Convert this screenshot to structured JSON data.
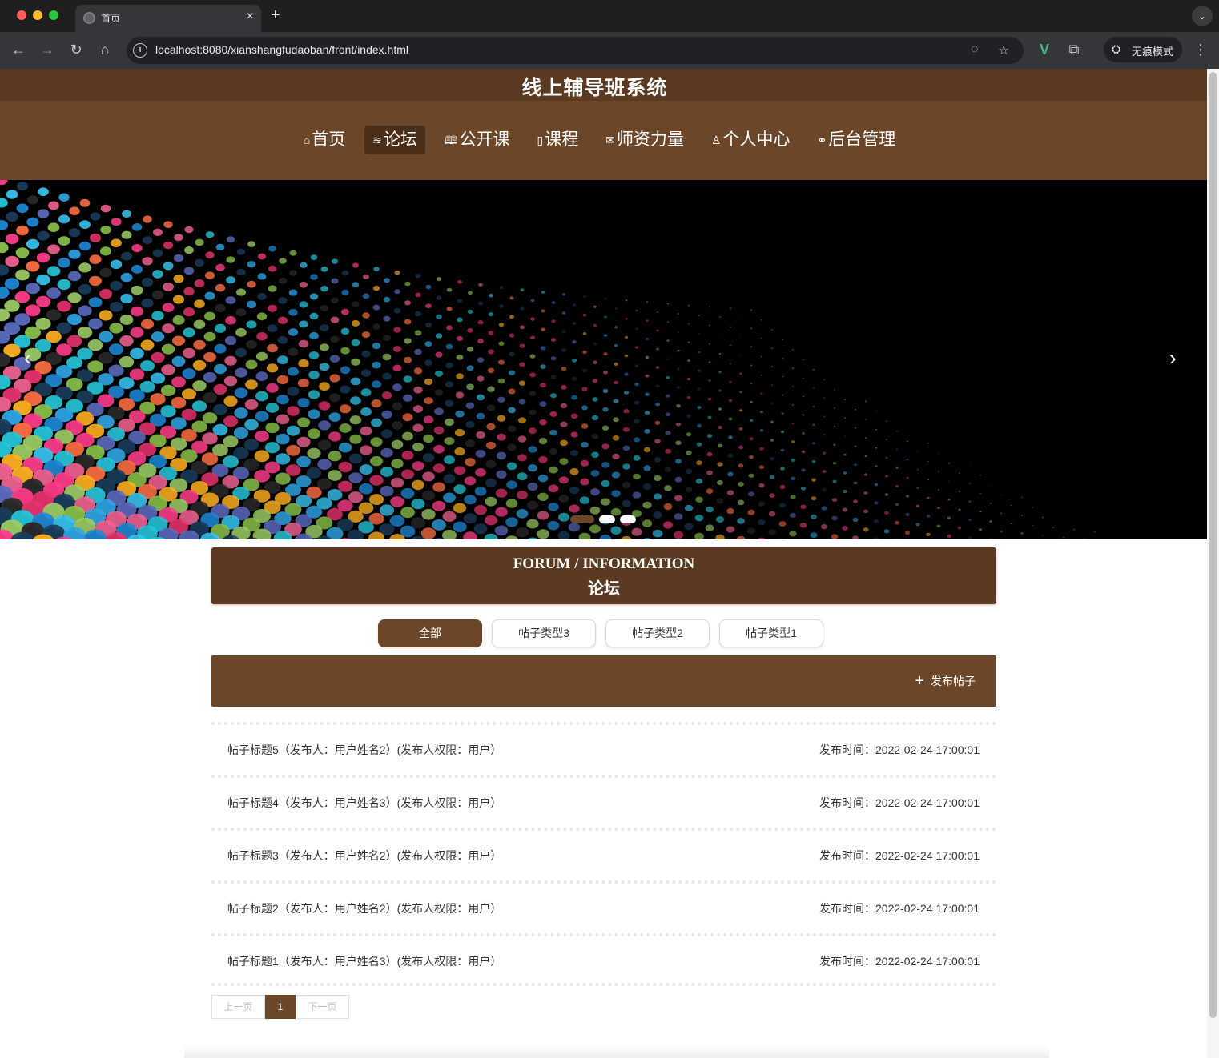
{
  "browser": {
    "tab_title": "首页",
    "new_tab": "+",
    "close": "×",
    "tab_menu": "⌄",
    "url": "localhost:8080/xianshangfudaoban/front/index.html",
    "incognito_label": "无痕模式"
  },
  "site": {
    "title": "线上辅导班系统"
  },
  "nav": {
    "items": [
      {
        "icon": "⌂",
        "label": "首页",
        "active": false
      },
      {
        "icon": "≋",
        "label": "论坛",
        "active": true
      },
      {
        "icon": "🕮",
        "label": "公开课",
        "active": false
      },
      {
        "icon": "▯",
        "label": "课程",
        "active": false
      },
      {
        "icon": "✉",
        "label": "师资力量",
        "active": false
      },
      {
        "icon": "♙",
        "label": "个人中心",
        "active": false
      },
      {
        "icon": "⚭",
        "label": "后台管理",
        "active": false
      }
    ]
  },
  "carousel": {
    "prev": "‹",
    "next": "›",
    "slide_count": 3,
    "active_index": 0
  },
  "forum": {
    "heading_en": "FORUM / INFORMATION",
    "heading_cn": "论坛",
    "categories": [
      {
        "label": "全部",
        "active": true
      },
      {
        "label": "帖子类型3",
        "active": false
      },
      {
        "label": "帖子类型2",
        "active": false
      },
      {
        "label": "帖子类型1",
        "active": false
      }
    ],
    "post_button": "发布帖子",
    "posts": [
      {
        "title": "帖子标题5（发布人：用户姓名2）(发布人权限：用户）",
        "time": "发布时间：2022-02-24 17:00:01"
      },
      {
        "title": "帖子标题4（发布人：用户姓名3）(发布人权限：用户）",
        "time": "发布时间：2022-02-24 17:00:01"
      },
      {
        "title": "帖子标题3（发布人：用户姓名2）(发布人权限：用户）",
        "time": "发布时间：2022-02-24 17:00:01"
      },
      {
        "title": "帖子标题2（发布人：用户姓名2）(发布人权限：用户）",
        "time": "发布时间：2022-02-24 17:00:01"
      },
      {
        "title": "帖子标题1（发布人：用户姓名3）(发布人权限：用户）",
        "time": "发布时间：2022-02-24 17:00:01"
      }
    ]
  },
  "pager": {
    "prev": "上一页",
    "current": "1",
    "next": "下一页"
  },
  "colors": {
    "header": "#5c3a21",
    "nav": "#6b4628",
    "active": "#4a2e18"
  }
}
